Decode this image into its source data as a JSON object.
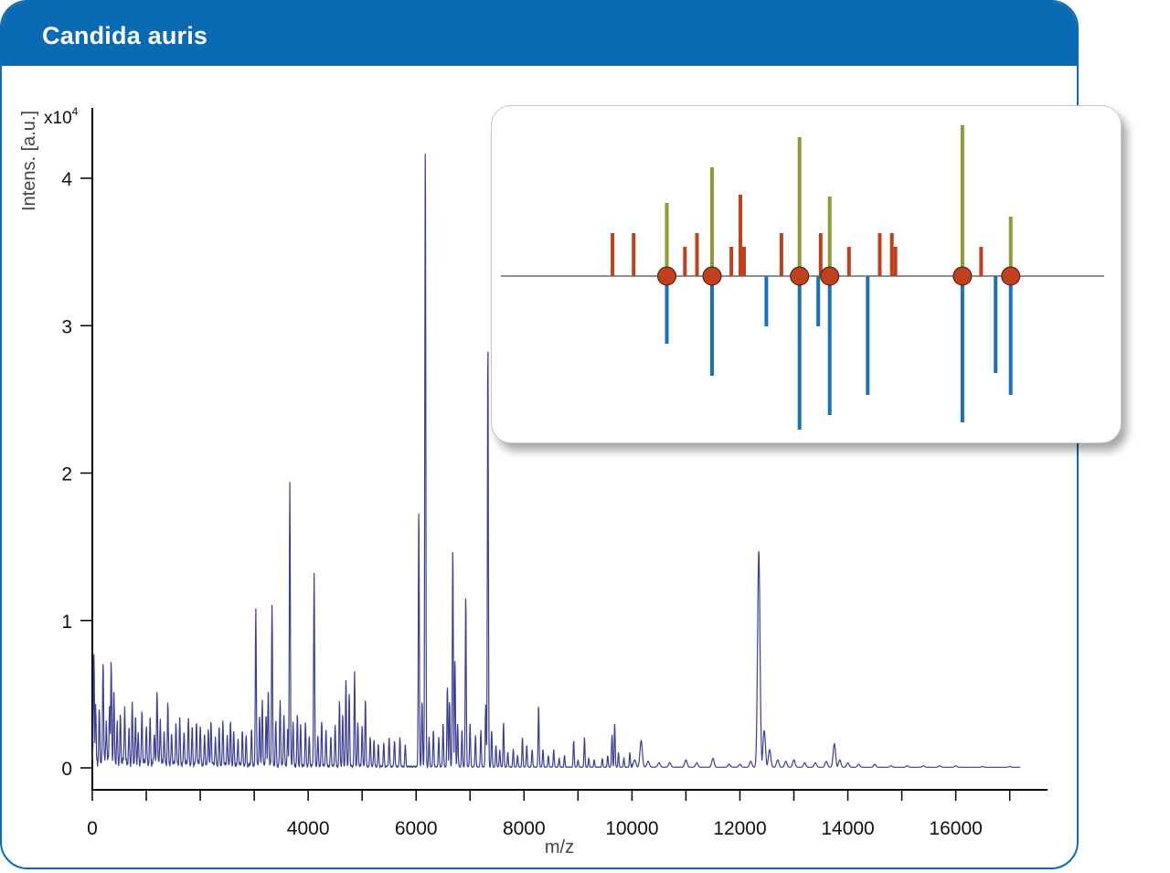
{
  "title": "Candida auris",
  "colors": {
    "brand": "#0a6ab4",
    "spectrum": "#3a3f94",
    "inset_red": "#c0401e",
    "inset_green": "#8a9e33",
    "inset_blue": "#1a72b6"
  },
  "chart_data": [
    {
      "type": "line",
      "xlabel": "m/z",
      "ylabel": "Intens. [a.u.]",
      "y_multiplier": "x10",
      "y_multiplier_exp": "4",
      "xlim": [
        0,
        17700
      ],
      "ylim": [
        0,
        4.5
      ],
      "x_ticks": [
        0,
        4000,
        6000,
        8000,
        10000,
        12000,
        14000,
        16000
      ],
      "x_tick_labels": [
        "0",
        "4000",
        "6000",
        "8000",
        "10000",
        "12000",
        "14000",
        "16000"
      ],
      "y_ticks": [
        0,
        1,
        2,
        3,
        4
      ],
      "y_tick_labels": [
        "0",
        "1",
        "2",
        "3",
        "4"
      ],
      "grid": false,
      "peaks": [
        [
          30,
          0.75
        ],
        [
          60,
          0.38
        ],
        [
          130,
          0.35
        ],
        [
          200,
          0.7
        ],
        [
          260,
          0.28
        ],
        [
          320,
          0.42
        ],
        [
          350,
          0.67
        ],
        [
          400,
          0.48
        ],
        [
          460,
          0.25
        ],
        [
          520,
          0.32
        ],
        [
          600,
          0.38
        ],
        [
          680,
          0.22
        ],
        [
          740,
          0.4
        ],
        [
          800,
          0.3
        ],
        [
          850,
          0.18
        ],
        [
          920,
          0.35
        ],
        [
          1000,
          0.25
        ],
        [
          1070,
          0.3
        ],
        [
          1150,
          0.22
        ],
        [
          1200,
          0.5
        ],
        [
          1260,
          0.3
        ],
        [
          1330,
          0.22
        ],
        [
          1400,
          0.4
        ],
        [
          1470,
          0.2
        ],
        [
          1550,
          0.28
        ],
        [
          1620,
          0.3
        ],
        [
          1700,
          0.22
        ],
        [
          1780,
          0.32
        ],
        [
          1850,
          0.25
        ],
        [
          1930,
          0.3
        ],
        [
          2000,
          0.27
        ],
        [
          2080,
          0.2
        ],
        [
          2150,
          0.25
        ],
        [
          2200,
          0.3
        ],
        [
          2280,
          0.18
        ],
        [
          2350,
          0.25
        ],
        [
          2420,
          0.3
        ],
        [
          2500,
          0.2
        ],
        [
          2560,
          0.3
        ],
        [
          2620,
          0.22
        ],
        [
          2700,
          0.18
        ],
        [
          2780,
          0.24
        ],
        [
          2850,
          0.2
        ],
        [
          2950,
          0.25
        ],
        [
          3030,
          1.06
        ],
        [
          3100,
          0.35
        ],
        [
          3150,
          0.45
        ],
        [
          3220,
          0.35
        ],
        [
          3260,
          0.52
        ],
        [
          3330,
          1.09
        ],
        [
          3400,
          0.3
        ],
        [
          3480,
          0.45
        ],
        [
          3550,
          0.35
        ],
        [
          3620,
          0.25
        ],
        [
          3660,
          1.93
        ],
        [
          3720,
          0.3
        ],
        [
          3800,
          0.35
        ],
        [
          3860,
          0.28
        ],
        [
          3950,
          0.3
        ],
        [
          4020,
          0.2
        ],
        [
          4110,
          1.31
        ],
        [
          4180,
          0.2
        ],
        [
          4250,
          0.3
        ],
        [
          4330,
          0.25
        ],
        [
          4420,
          0.2
        ],
        [
          4500,
          0.28
        ],
        [
          4580,
          0.45
        ],
        [
          4640,
          0.35
        ],
        [
          4700,
          0.6
        ],
        [
          4760,
          0.5
        ],
        [
          4860,
          0.64
        ],
        [
          4920,
          0.3
        ],
        [
          5000,
          0.28
        ],
        [
          5060,
          0.46
        ],
        [
          5150,
          0.2
        ],
        [
          5220,
          0.18
        ],
        [
          5300,
          0.15
        ],
        [
          5400,
          0.16
        ],
        [
          5500,
          0.2
        ],
        [
          5600,
          0.18
        ],
        [
          5700,
          0.2
        ],
        [
          5800,
          0.15
        ],
        [
          6050,
          1.76
        ],
        [
          6110,
          0.45
        ],
        [
          6170,
          4.26
        ],
        [
          6240,
          0.2
        ],
        [
          6320,
          0.25
        ],
        [
          6420,
          0.2
        ],
        [
          6500,
          0.3
        ],
        [
          6580,
          0.55
        ],
        [
          6620,
          0.45
        ],
        [
          6680,
          1.49
        ],
        [
          6720,
          0.72
        ],
        [
          6770,
          0.3
        ],
        [
          6850,
          0.25
        ],
        [
          6920,
          1.17
        ],
        [
          7000,
          0.3
        ],
        [
          7100,
          0.22
        ],
        [
          7200,
          0.25
        ],
        [
          7290,
          0.42
        ],
        [
          7330,
          2.89
        ],
        [
          7400,
          0.25
        ],
        [
          7480,
          0.15
        ],
        [
          7550,
          0.12
        ],
        [
          7620,
          0.3
        ],
        [
          7700,
          0.1
        ],
        [
          7800,
          0.12
        ],
        [
          7880,
          0.08
        ],
        [
          7970,
          0.2
        ],
        [
          8050,
          0.15
        ],
        [
          8150,
          0.12
        ],
        [
          8270,
          0.42
        ],
        [
          8350,
          0.12
        ],
        [
          8450,
          0.08
        ],
        [
          8550,
          0.12
        ],
        [
          8650,
          0.06
        ],
        [
          8750,
          0.08
        ],
        [
          8920,
          0.18
        ],
        [
          9000,
          0.05
        ],
        [
          9120,
          0.2
        ],
        [
          9200,
          0.06
        ],
        [
          9300,
          0.05
        ],
        [
          9450,
          0.06
        ],
        [
          9550,
          0.08
        ],
        [
          9630,
          0.22
        ],
        [
          9680,
          0.3
        ],
        [
          9750,
          0.1
        ],
        [
          9850,
          0.06
        ],
        [
          9960,
          0.1
        ],
        [
          10050,
          0.05
        ],
        [
          10170,
          0.18
        ],
        [
          10300,
          0.04
        ],
        [
          10500,
          0.03
        ],
        [
          10700,
          0.03
        ],
        [
          11000,
          0.05
        ],
        [
          11200,
          0.03
        ],
        [
          11500,
          0.06
        ],
        [
          11800,
          0.02
        ],
        [
          12000,
          0.02
        ],
        [
          12200,
          0.04
        ],
        [
          12350,
          1.47
        ],
        [
          12450,
          0.25
        ],
        [
          12550,
          0.12
        ],
        [
          12700,
          0.05
        ],
        [
          12850,
          0.04
        ],
        [
          13000,
          0.05
        ],
        [
          13200,
          0.03
        ],
        [
          13400,
          0.03
        ],
        [
          13600,
          0.04
        ],
        [
          13750,
          0.16
        ],
        [
          13850,
          0.05
        ],
        [
          14000,
          0.03
        ],
        [
          14200,
          0.02
        ],
        [
          14500,
          0.02
        ],
        [
          14800,
          0.01
        ],
        [
          15100,
          0.01
        ],
        [
          15400,
          0.01
        ],
        [
          15700,
          0.01
        ],
        [
          16000,
          0.01
        ],
        [
          16500,
          0.005
        ],
        [
          17000,
          0.005
        ]
      ]
    },
    {
      "type": "bar",
      "description_hidden": false,
      "baseline": 0,
      "markers": [
        0.275,
        0.35,
        0.495,
        0.545,
        0.765,
        0.845
      ],
      "bars": [
        {
          "pos": 0.185,
          "value": 0.47,
          "color": "red"
        },
        {
          "pos": 0.22,
          "value": 0.47,
          "color": "red"
        },
        {
          "pos": 0.275,
          "value": 0.8,
          "color": "green"
        },
        {
          "pos": 0.275,
          "value": -0.74,
          "color": "blue"
        },
        {
          "pos": 0.305,
          "value": 0.32,
          "color": "red"
        },
        {
          "pos": 0.325,
          "value": 0.47,
          "color": "red"
        },
        {
          "pos": 0.35,
          "value": 1.19,
          "color": "green"
        },
        {
          "pos": 0.35,
          "value": -1.09,
          "color": "blue"
        },
        {
          "pos": 0.382,
          "value": 0.32,
          "color": "red"
        },
        {
          "pos": 0.397,
          "value": 0.89,
          "color": "red"
        },
        {
          "pos": 0.403,
          "value": 0.32,
          "color": "red"
        },
        {
          "pos": 0.44,
          "value": -0.55,
          "color": "blue"
        },
        {
          "pos": 0.465,
          "value": 0.47,
          "color": "red"
        },
        {
          "pos": 0.495,
          "value": 1.52,
          "color": "green"
        },
        {
          "pos": 0.495,
          "value": -1.68,
          "color": "blue"
        },
        {
          "pos": 0.526,
          "value": -0.55,
          "color": "blue"
        },
        {
          "pos": 0.53,
          "value": 0.47,
          "color": "red"
        },
        {
          "pos": 0.545,
          "value": 0.87,
          "color": "green"
        },
        {
          "pos": 0.545,
          "value": -1.52,
          "color": "blue"
        },
        {
          "pos": 0.577,
          "value": 0.32,
          "color": "red"
        },
        {
          "pos": 0.608,
          "value": -1.3,
          "color": "blue"
        },
        {
          "pos": 0.628,
          "value": 0.47,
          "color": "red"
        },
        {
          "pos": 0.648,
          "value": 0.47,
          "color": "red"
        },
        {
          "pos": 0.654,
          "value": 0.32,
          "color": "red"
        },
        {
          "pos": 0.765,
          "value": 1.65,
          "color": "green"
        },
        {
          "pos": 0.765,
          "value": -1.6,
          "color": "blue"
        },
        {
          "pos": 0.796,
          "value": 0.32,
          "color": "red"
        },
        {
          "pos": 0.82,
          "value": -1.06,
          "color": "blue"
        },
        {
          "pos": 0.845,
          "value": 0.65,
          "color": "green"
        },
        {
          "pos": 0.845,
          "value": -1.3,
          "color": "blue"
        }
      ]
    }
  ]
}
